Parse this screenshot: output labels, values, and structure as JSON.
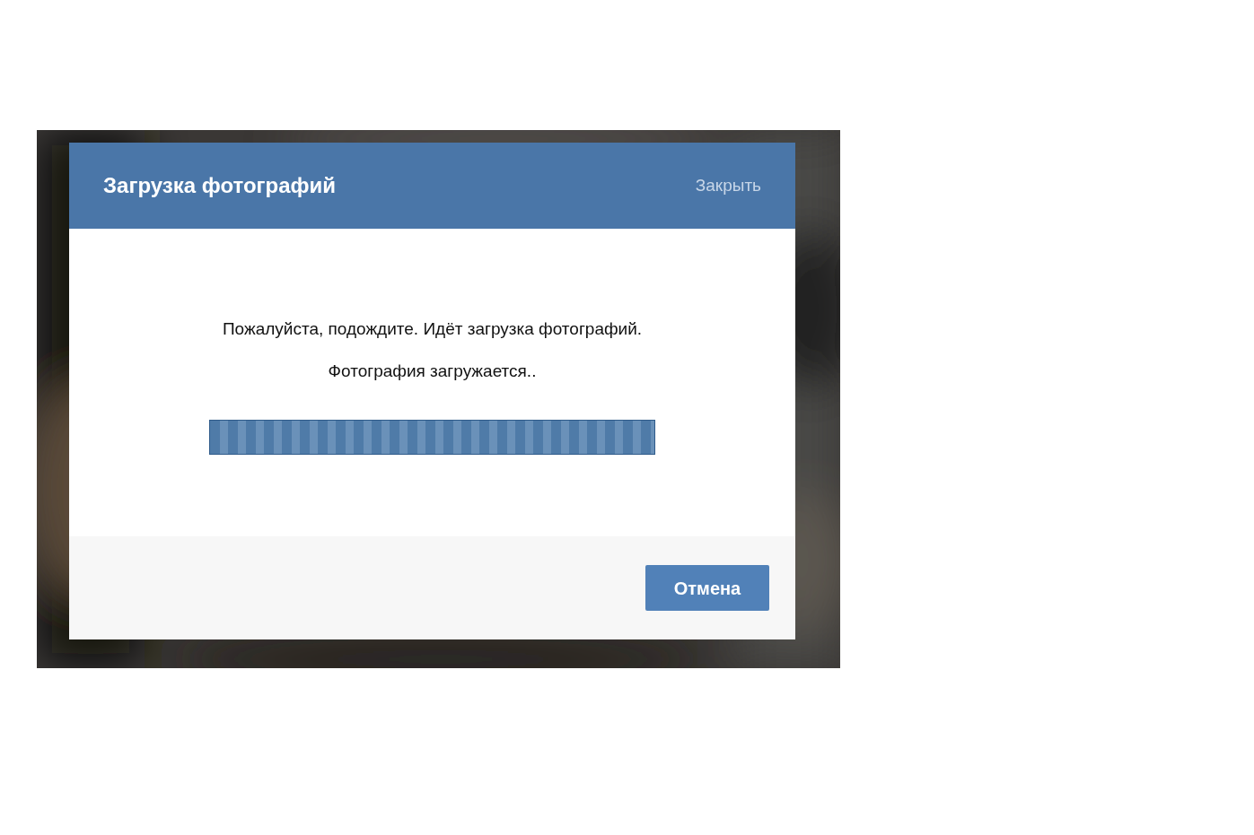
{
  "dialog": {
    "title": "Загрузка фотографий",
    "close_link": "Закрыть",
    "message": "Пожалуйста, подождите. Идёт загрузка фотографий.",
    "status": "Фотография загружается..",
    "progress": {
      "level": 1
    },
    "buttons": [
      "Отмена"
    ]
  }
}
